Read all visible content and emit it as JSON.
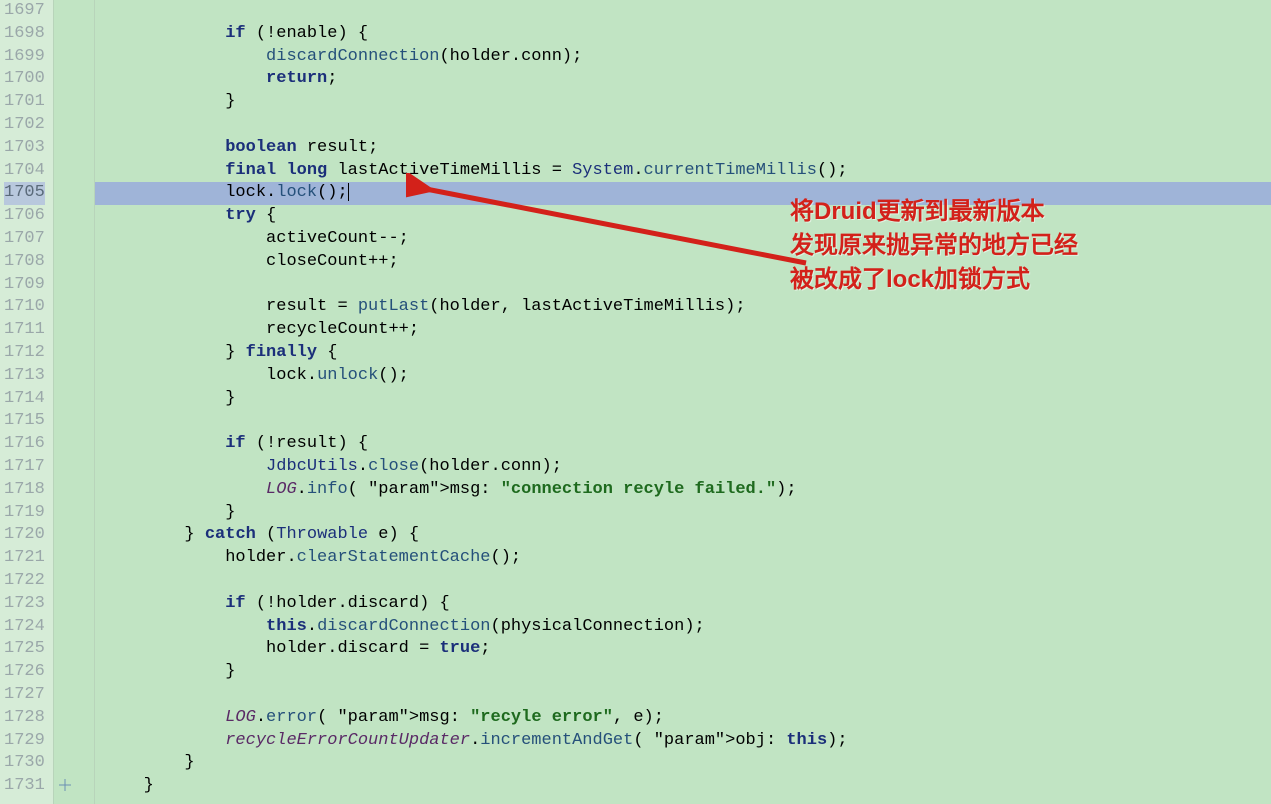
{
  "lineStart": 1697,
  "lines": [
    "",
    "            if (!enable) {",
    "                discardConnection(holder.conn);",
    "                return;",
    "            }",
    "",
    "            boolean result;",
    "            final long lastActiveTimeMillis = System.currentTimeMillis();",
    "            lock.lock();",
    "            try {",
    "                activeCount--;",
    "                closeCount++;",
    "",
    "                result = putLast(holder, lastActiveTimeMillis);",
    "                recycleCount++;",
    "            } finally {",
    "                lock.unlock();",
    "            }",
    "",
    "            if (!result) {",
    "                JdbcUtils.close(holder.conn);",
    "                LOG.info( msg: \"connection recyle failed.\");",
    "            }",
    "        } catch (Throwable e) {",
    "            holder.clearStatementCache();",
    "",
    "            if (!holder.discard) {",
    "                this.discardConnection(physicalConnection);",
    "                holder.discard = true;",
    "            }",
    "",
    "            LOG.error( msg: \"recyle error\", e);",
    "            recycleErrorCountUpdater.incrementAndGet( obj: this);",
    "        }",
    "    }"
  ],
  "highlightLine": 1705,
  "annotation": {
    "line1": "将Druid更新到最新版本",
    "line2": "发现原来抛异常的地方已经",
    "line3": "被改成了lock加锁方式"
  }
}
